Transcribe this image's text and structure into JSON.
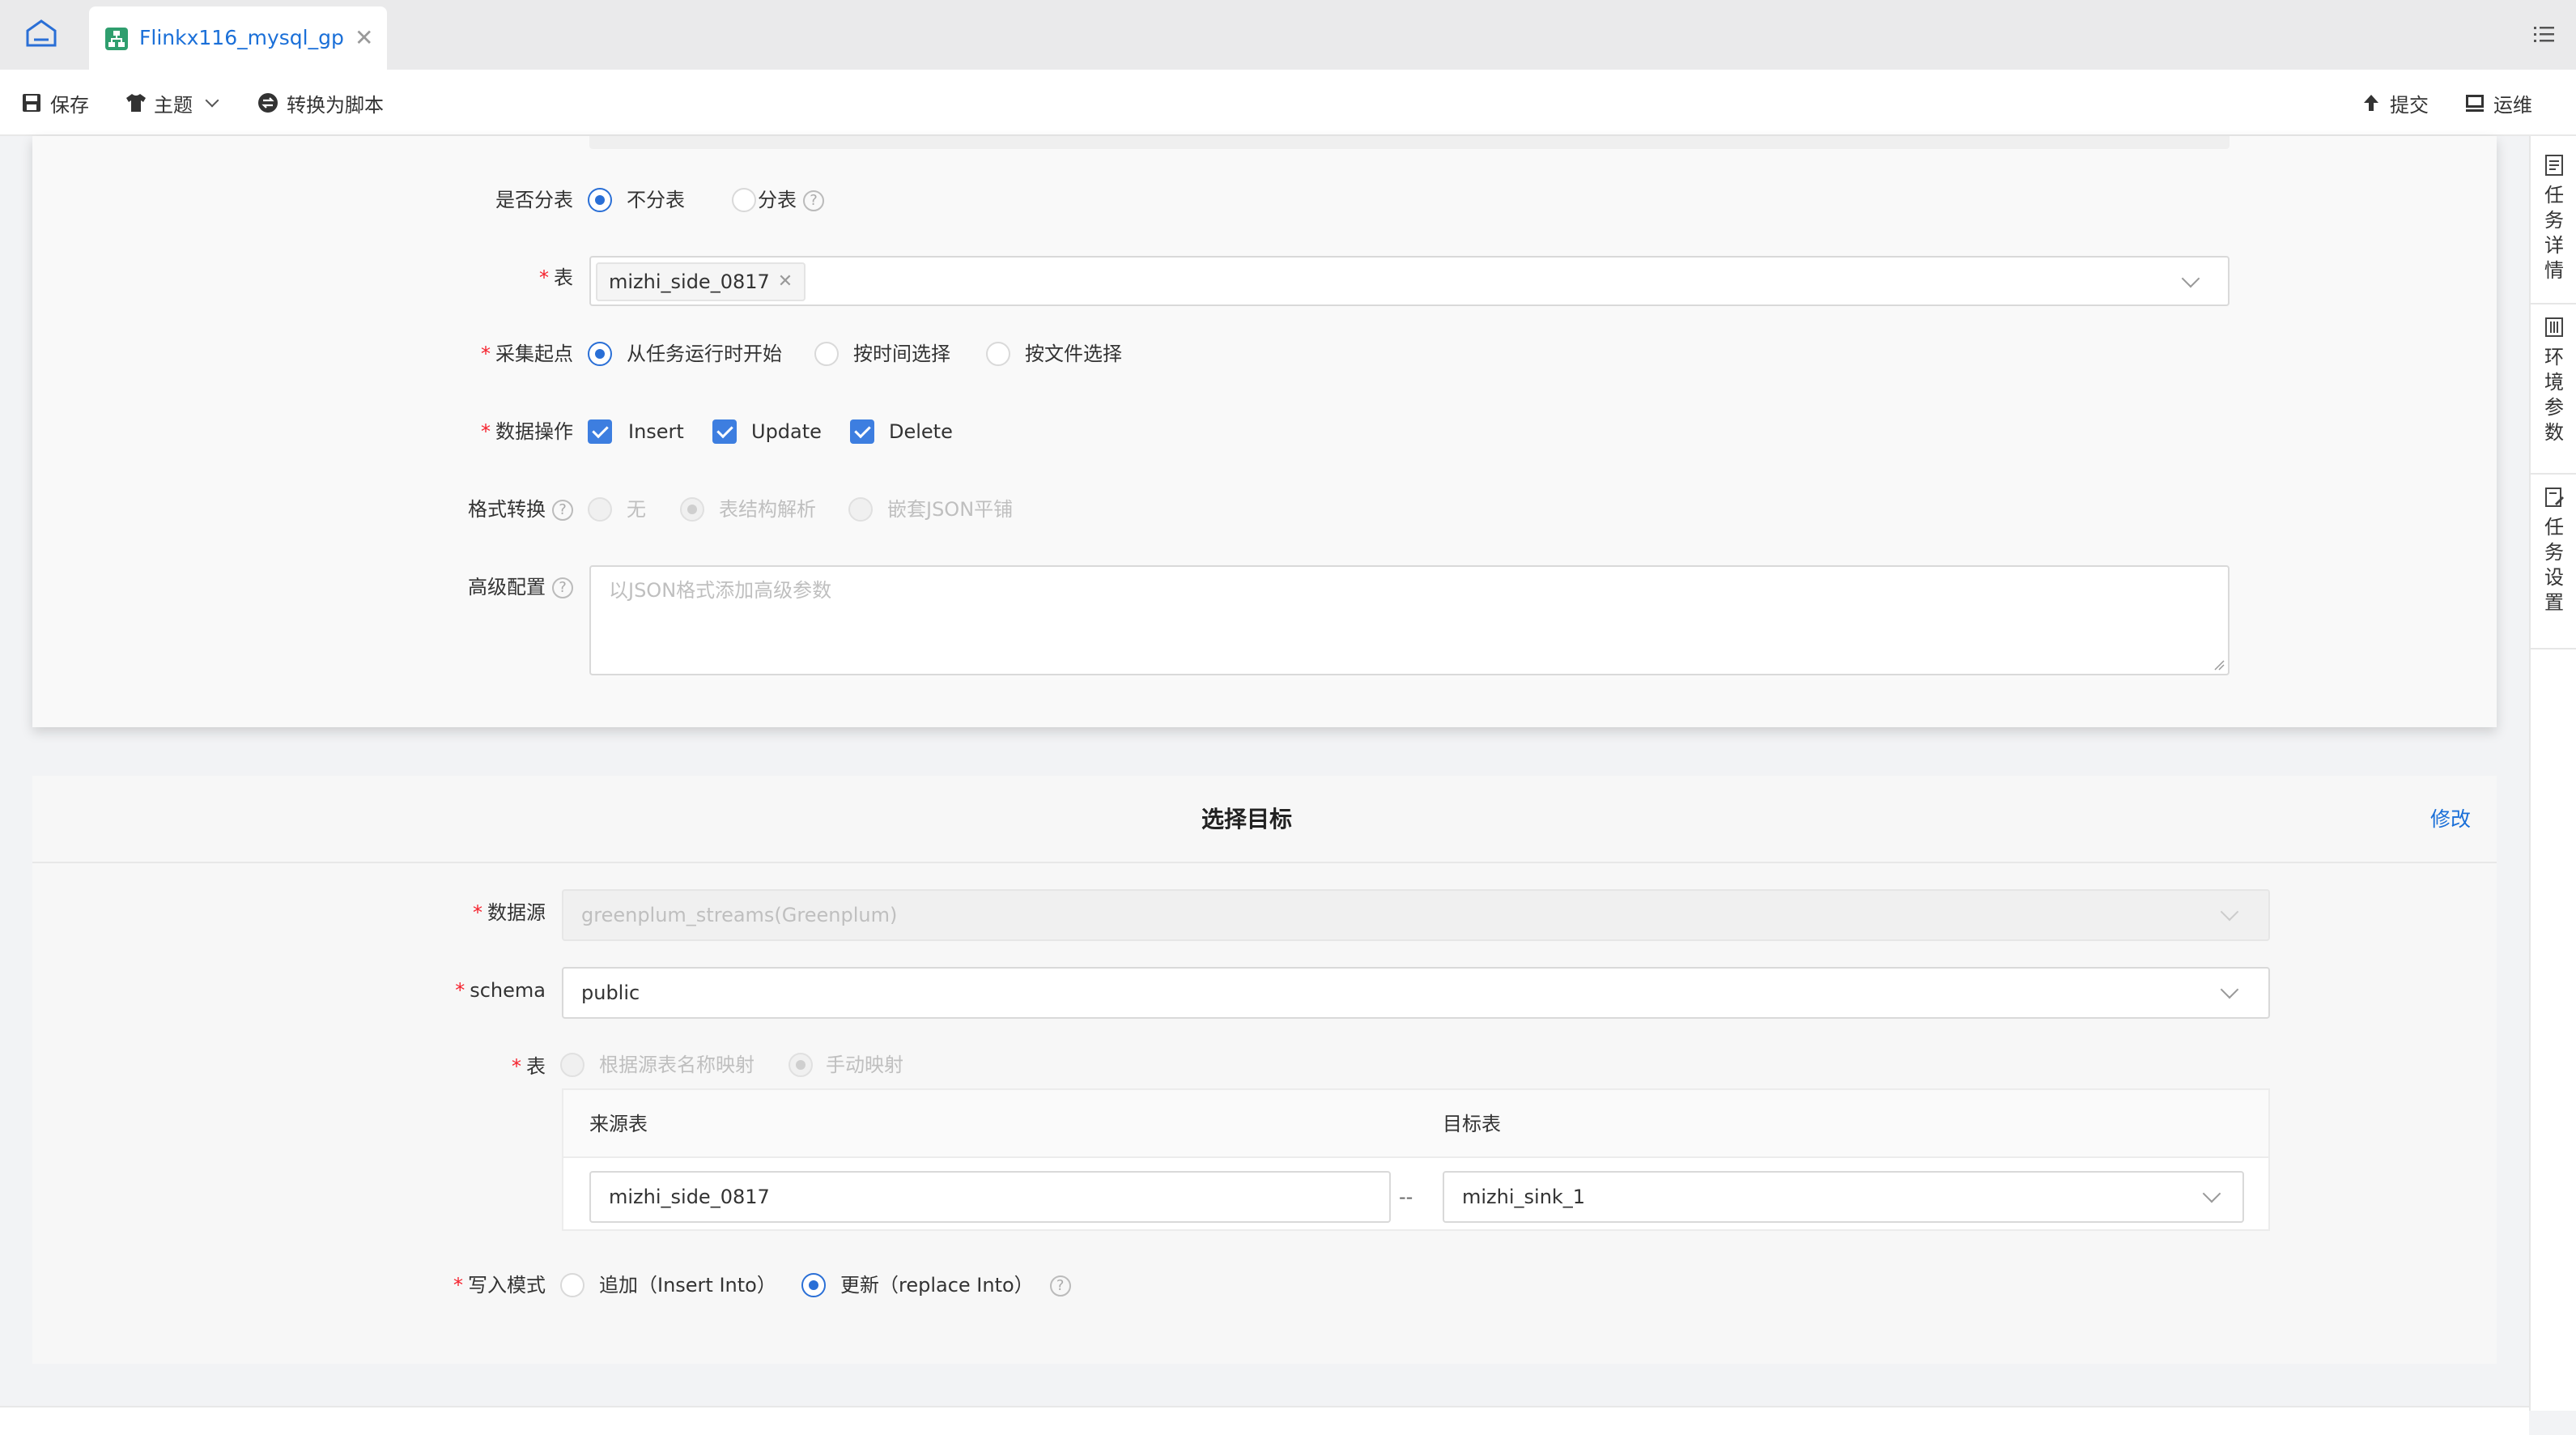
{
  "tab_bar": {
    "home_icon": "home-icon",
    "tab_icon": "flow-icon",
    "tab_title": "Flinkx116_mysql_gp",
    "close_icon": "close-icon",
    "menu_icon": "list-menu-icon"
  },
  "toolbar": {
    "save": "保存",
    "theme": "主题",
    "convert": "转换为脚本",
    "submit": "提交",
    "ops": "运维"
  },
  "right_rail": [
    "任务详情",
    "环境参数",
    "任务设置"
  ],
  "source": {
    "shard_label": "是否分表",
    "shard_options": [
      "不分表",
      "分表"
    ],
    "shard_selected": "不分表",
    "table_label": "表",
    "table_tag": "mizhi_side_0817",
    "start_label": "采集起点",
    "start_options": [
      "从任务运行时开始",
      "按时间选择",
      "按文件选择"
    ],
    "start_selected": "从任务运行时开始",
    "ops_label": "数据操作",
    "ops_options": [
      "Insert",
      "Update",
      "Delete"
    ],
    "format_label": "格式转换",
    "format_options": [
      "无",
      "表结构解析",
      "嵌套JSON平铺"
    ],
    "format_selected": "表结构解析",
    "advanced_label": "高级配置",
    "advanced_placeholder": "以JSON格式添加高级参数"
  },
  "target": {
    "title": "选择目标",
    "edit": "修改",
    "datasource_label": "数据源",
    "datasource_value": "greenplum_streams(Greenplum)",
    "schema_label": "schema",
    "schema_value": "public",
    "table_label": "表",
    "map_options": [
      "根据源表名称映射",
      "手动映射"
    ],
    "map_selected": "手动映射",
    "col_source": "来源表",
    "col_target": "目标表",
    "source_table": "mizhi_side_0817",
    "separator": "--",
    "target_table": "mizhi_sink_1",
    "write_label": "写入模式",
    "write_options": [
      "追加（Insert Into）",
      "更新（replace Into）"
    ],
    "write_selected": "更新（replace Into）"
  }
}
